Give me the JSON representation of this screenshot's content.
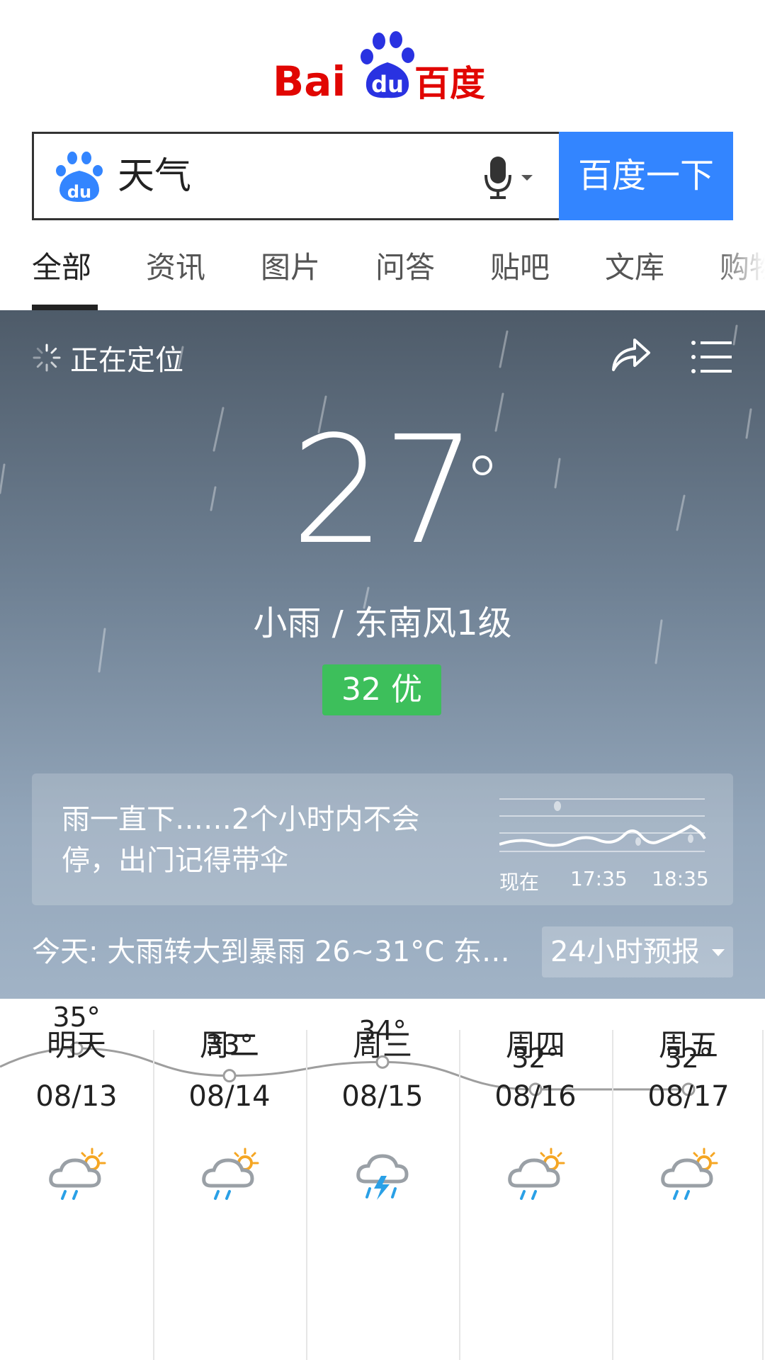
{
  "brand": {
    "logo_text": "Bai du 百度"
  },
  "search": {
    "query": "天气",
    "button_label": "百度一下"
  },
  "tabs": [
    {
      "label": "全部",
      "active": true
    },
    {
      "label": "资讯"
    },
    {
      "label": "图片"
    },
    {
      "label": "问答"
    },
    {
      "label": "贴吧"
    },
    {
      "label": "文库"
    },
    {
      "label": "购物"
    }
  ],
  "weather": {
    "location_status": "正在定位",
    "temperature": "27",
    "condition": "小雨 / 东南风1级",
    "aqi": "32 优",
    "rain_message": "雨一直下……2个小时内不会停，出门记得带伞",
    "rain_chart_labels": [
      "现在",
      "17:35",
      "18:35"
    ],
    "today_summary": "今天:  大雨转大到暴雨   26~31°C   东…",
    "forecast_button": "24小时预报"
  },
  "forecast": [
    {
      "day": "明天",
      "date": "08/13",
      "icon": "cloud-sun-rain-icon",
      "high": "35°",
      "high_value": 35
    },
    {
      "day": "周二",
      "date": "08/14",
      "icon": "cloud-sun-rain-icon",
      "high": "33°",
      "high_value": 33
    },
    {
      "day": "周三",
      "date": "08/15",
      "icon": "cloud-thunder-rain-icon",
      "high": "34°",
      "high_value": 34
    },
    {
      "day": "周四",
      "date": "08/16",
      "icon": "cloud-sun-rain-icon",
      "high": "32°",
      "high_value": 32
    },
    {
      "day": "周五",
      "date": "08/17",
      "icon": "cloud-sun-rain-icon",
      "high": "32°",
      "high_value": 32
    }
  ],
  "colors": {
    "accent_blue": "#3385ff",
    "baidu_red": "#e10602",
    "aqi_green": "#3dbf5b"
  }
}
